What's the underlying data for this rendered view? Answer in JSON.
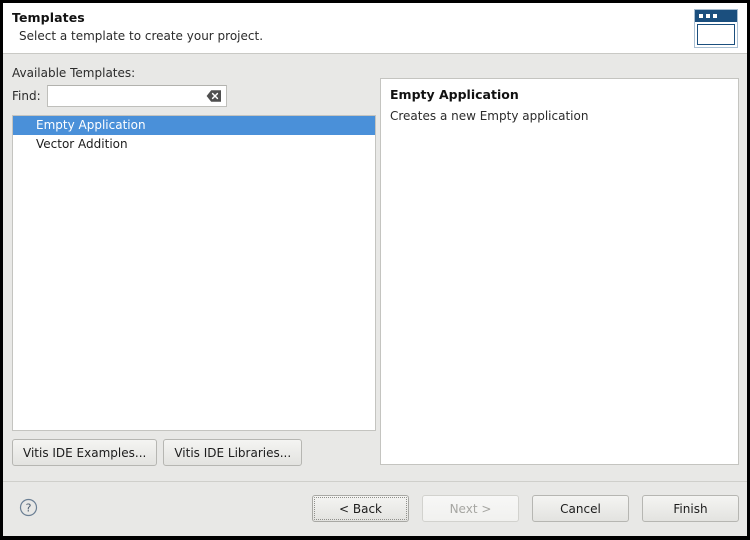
{
  "window": {
    "header": {
      "title": "Templates",
      "subtitle": "Select a template to create your project.",
      "icon": "wizard-window-icon"
    }
  },
  "body": {
    "available_label": "Available Templates:",
    "find": {
      "label": "Find:",
      "value": "",
      "placeholder": "",
      "clear_icon": "clear-field-icon"
    },
    "templates": [
      {
        "name": "Empty Application",
        "selected": true
      },
      {
        "name": "Vector Addition",
        "selected": false
      }
    ],
    "example_buttons": [
      {
        "label": "Vitis IDE Examples..."
      },
      {
        "label": "Vitis IDE Libraries..."
      }
    ],
    "description": {
      "title": "Empty Application",
      "text": "Creates a new Empty application"
    }
  },
  "footer": {
    "help_icon": "help-question-icon",
    "buttons": [
      {
        "label": "< Back",
        "state": "focused"
      },
      {
        "label": "Next >",
        "state": "disabled"
      },
      {
        "label": "Cancel",
        "state": "normal"
      },
      {
        "label": "Finish",
        "state": "normal"
      }
    ]
  },
  "colors": {
    "selection_blue": "#4a90d9",
    "icon_navy": "#1b4f7e",
    "dialog_bg": "#e8e8e6",
    "panel_white": "#ffffff"
  }
}
